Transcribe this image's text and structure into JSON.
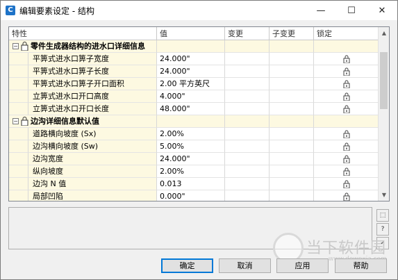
{
  "window": {
    "title": "编辑要素设定 - 结构",
    "app_icon_glyph": "C",
    "controls": {
      "minimize": "—",
      "maximize": "☐",
      "close": "✕"
    }
  },
  "grid": {
    "columns": [
      "特性",
      "值",
      "变更",
      "子变更",
      "锁定"
    ],
    "groups": [
      {
        "toggle": "⊟",
        "label": "零件生成器结构的进水口详细信息",
        "rows": [
          {
            "name": "平箅式进水口箅子宽度",
            "value": "24.000\"",
            "locked": true
          },
          {
            "name": "平箅式进水口箅子长度",
            "value": "24.000\"",
            "locked": true
          },
          {
            "name": "平箅式进水口箅子开口面积",
            "value": "2.00 平方英尺",
            "locked": true
          },
          {
            "name": "立箅式进水口开口高度",
            "value": "4.000\"",
            "locked": true
          },
          {
            "name": "立箅式进水口开口长度",
            "value": "48.000\"",
            "locked": true
          }
        ]
      },
      {
        "toggle": "⊟",
        "label": "边沟详细信息默认值",
        "rows": [
          {
            "name": "道路横向坡度 (Sx)",
            "value": "2.00%",
            "locked": true
          },
          {
            "name": "边沟横向坡度 (Sw)",
            "value": "5.00%",
            "locked": true
          },
          {
            "name": "边沟宽度",
            "value": "24.000\"",
            "locked": true
          },
          {
            "name": "纵向坡度",
            "value": "2.00%",
            "locked": true
          },
          {
            "name": "边沟 N 值",
            "value": "0.013",
            "locked": true
          },
          {
            "name": "局部凹陷",
            "value": "0.000\"",
            "locked": true
          }
        ]
      }
    ],
    "scroll_up": "▲",
    "scroll_down": "▼"
  },
  "side_buttons": [
    "⬚",
    "?",
    "✓"
  ],
  "buttons": {
    "ok": "确定",
    "cancel": "取消",
    "apply": "应用",
    "help": "帮助"
  },
  "watermark": {
    "text": "当下软件园",
    "url": "www.downxia.com"
  },
  "colors": {
    "group_bg": "#fdf9e1",
    "accent": "#0078d7"
  }
}
